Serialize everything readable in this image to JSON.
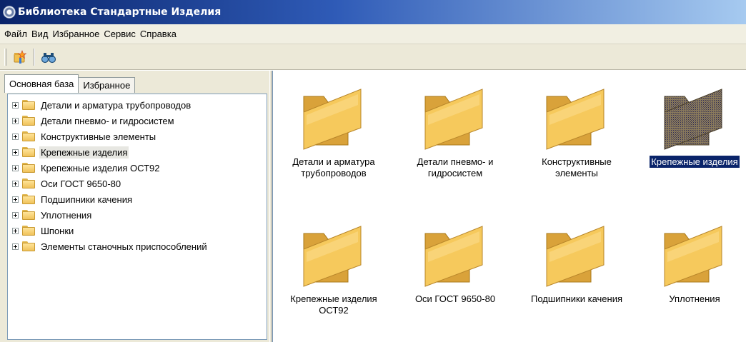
{
  "window": {
    "title": "Библиотека Стандартные Изделия"
  },
  "menu": [
    "Файл",
    "Вид",
    "Избранное",
    "Сервис",
    "Справка"
  ],
  "toolbar": {
    "buttons": [
      "add-favorite-icon",
      "binoculars-search-icon"
    ]
  },
  "tabs": [
    {
      "label": "Основная база",
      "active": true
    },
    {
      "label": "Избранное",
      "active": false
    }
  ],
  "tree": [
    {
      "label": "Детали и арматура трубопроводов"
    },
    {
      "label": "Детали пневмо- и гидросистем"
    },
    {
      "label": "Конструктивные элементы"
    },
    {
      "label": "Крепежные изделия",
      "selected": true
    },
    {
      "label": "Крепежные изделия ОСТ92"
    },
    {
      "label": "Оси ГОСТ 9650-80"
    },
    {
      "label": "Подшипники качения"
    },
    {
      "label": "Уплотнения"
    },
    {
      "label": "Шпонки"
    },
    {
      "label": "Элементы станочных приспособлений"
    }
  ],
  "items": [
    {
      "line1": "Детали и арматура",
      "line2": "трубопроводов"
    },
    {
      "line1": "Детали пневмо- и",
      "line2": "гидросистем"
    },
    {
      "line1": "Конструктивные",
      "line2": "элементы"
    },
    {
      "line1": "Крепежные изделия",
      "line2": "",
      "selected": true
    },
    {
      "line1": "Крепежные изделия",
      "line2": "ОСТ92"
    },
    {
      "line1": "Оси ГОСТ 9650-80",
      "line2": ""
    },
    {
      "line1": "Подшипники качения",
      "line2": ""
    },
    {
      "line1": "Уплотнения",
      "line2": ""
    }
  ],
  "colors": {
    "titlebar": "#0a246a",
    "folder": "#f2c14e",
    "selection": "#0a246a"
  }
}
